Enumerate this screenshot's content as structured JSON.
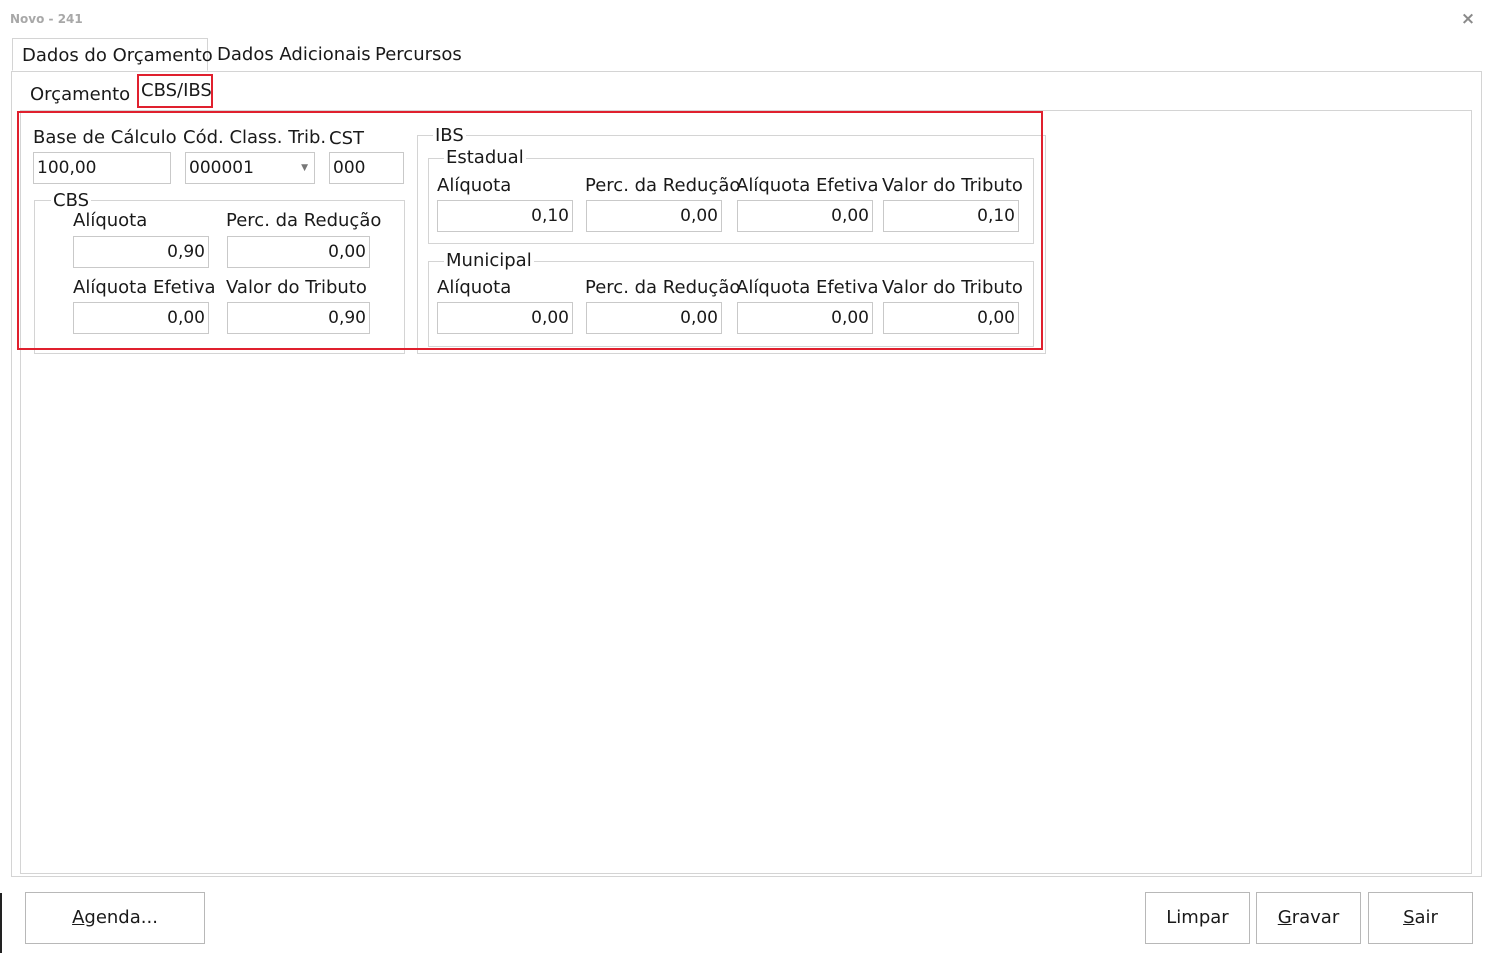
{
  "window": {
    "title": "Novo - 241",
    "close_glyph": "×"
  },
  "outer_tabs": [
    {
      "label": "Dados do Orçamento",
      "active": true
    },
    {
      "label": "Dados Adicionais",
      "active": false
    },
    {
      "label": "Percursos",
      "active": false
    }
  ],
  "inner_tabs": [
    {
      "label": "Orçamento",
      "active": false
    },
    {
      "label": "CBS/IBS",
      "active": true
    }
  ],
  "form": {
    "base_calculo": {
      "label": "Base de Cálculo",
      "value": "100,00"
    },
    "cod_class_trib": {
      "label": "Cód. Class. Trib.",
      "value": "000001"
    },
    "cst": {
      "label": "CST",
      "value": "000"
    },
    "cbs": {
      "legend": "CBS",
      "aliquota": {
        "label": "Alíquota",
        "value": "0,90"
      },
      "perc_reducao": {
        "label": "Perc. da Redução",
        "value": "0,00"
      },
      "aliquota_efetiva": {
        "label": "Alíquota Efetiva",
        "value": "0,00"
      },
      "valor_tributo": {
        "label": "Valor do Tributo",
        "value": "0,90"
      }
    },
    "ibs": {
      "legend": "IBS",
      "estadual": {
        "legend": "Estadual",
        "aliquota": {
          "label": "Alíquota",
          "value": "0,10"
        },
        "perc_reducao": {
          "label": "Perc. da Redução",
          "value": "0,00"
        },
        "aliquota_efetiva": {
          "label": "Alíquota Efetiva",
          "value": "0,00"
        },
        "valor_tributo": {
          "label": "Valor do Tributo",
          "value": "0,10"
        }
      },
      "municipal": {
        "legend": "Municipal",
        "aliquota": {
          "label": "Alíquota",
          "value": "0,00"
        },
        "perc_reducao": {
          "label": "Perc. da Redução",
          "value": "0,00"
        },
        "aliquota_efetiva": {
          "label": "Alíquota Efetiva",
          "value": "0,00"
        },
        "valor_tributo": {
          "label": "Valor do Tributo",
          "value": "0,00"
        }
      }
    }
  },
  "buttons": {
    "agenda": {
      "mnemonic": "A",
      "rest": "genda..."
    },
    "limpar": {
      "label": "Limpar"
    },
    "gravar": {
      "mnemonic": "G",
      "rest": "ravar"
    },
    "sair": {
      "mnemonic": "S",
      "rest": "air"
    }
  },
  "colors": {
    "highlight": "#e0202e",
    "border": "#d4d4d4",
    "title_text": "#a8a8a8"
  }
}
